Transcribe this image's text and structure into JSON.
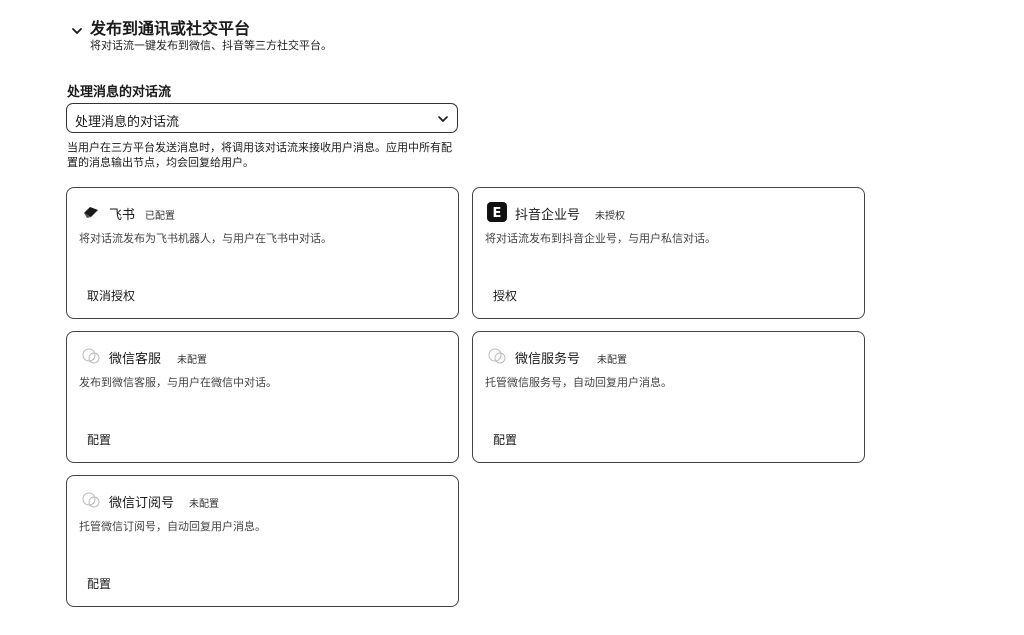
{
  "section": {
    "title": "发布到通讯或社交平台",
    "description": "将对话流一键发布到微信、抖音等三方社交平台。"
  },
  "flow_field": {
    "label": "处理消息的对话流",
    "selected": "处理消息的对话流",
    "hint": "当用户在三方平台发送消息时，将调用该对话流来接收用户消息。应用中所有配置的消息输出节点，均会回复给用户。"
  },
  "cards": [
    {
      "name": "飞书",
      "status": "已配置",
      "description": "将对话流发布为飞书机器人，与用户在飞书中对话。",
      "action": "取消授权",
      "icon": "feishu-icon"
    },
    {
      "name": "抖音企业号",
      "status": "未授权",
      "description": "将对话流发布到抖音企业号，与用户私信对话。",
      "action": "授权",
      "icon": "douyin-icon"
    },
    {
      "name": "微信客服",
      "status": "未配置",
      "description": "发布到微信客服，与用户在微信中对话。",
      "action": "配置",
      "icon": "wechat-kefu-icon"
    },
    {
      "name": "微信服务号",
      "status": "未配置",
      "description": "托管微信服务号，自动回复用户消息。",
      "action": "配置",
      "icon": "wechat-service-icon"
    },
    {
      "name": "微信订阅号",
      "status": "未配置",
      "description": "托管微信订阅号，自动回复用户消息。",
      "action": "配置",
      "icon": "wechat-subscription-icon"
    }
  ]
}
